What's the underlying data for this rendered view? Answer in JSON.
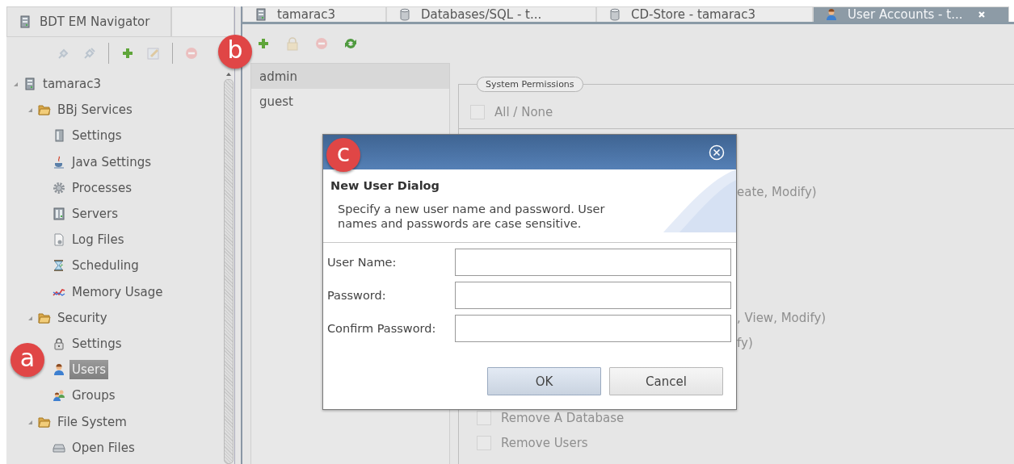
{
  "navigator": {
    "tab": {
      "label": "BDT EM Navigator",
      "selected": true
    },
    "tree": [
      {
        "label": "tamarac3",
        "kind": "server",
        "expanded": true,
        "selected": false,
        "children": [
          {
            "label": "BBj Services",
            "kind": "folder",
            "expanded": true,
            "selected": false,
            "children": [
              {
                "label": "Settings",
                "kind": "settings",
                "selected": false
              },
              {
                "label": "Java Settings",
                "kind": "java",
                "selected": false
              },
              {
                "label": "Processes",
                "kind": "gear",
                "selected": false
              },
              {
                "label": "Servers",
                "kind": "servers",
                "selected": false
              },
              {
                "label": "Log Files",
                "kind": "log",
                "selected": false
              },
              {
                "label": "Scheduling",
                "kind": "schedule",
                "selected": false
              },
              {
                "label": "Memory Usage",
                "kind": "chart",
                "selected": false
              }
            ]
          },
          {
            "label": "Security",
            "kind": "folder",
            "expanded": true,
            "selected": false,
            "children": [
              {
                "label": "Settings",
                "kind": "lock",
                "selected": false
              },
              {
                "label": "Users",
                "kind": "user",
                "selected": true
              },
              {
                "label": "Groups",
                "kind": "group",
                "selected": false
              }
            ]
          },
          {
            "label": "File System",
            "kind": "folder",
            "expanded": true,
            "selected": false,
            "children": [
              {
                "label": "Open Files",
                "kind": "drive",
                "selected": false
              }
            ]
          }
        ]
      }
    ]
  },
  "tabs": [
    {
      "label": "tamarac3",
      "kind": "server",
      "selected": false
    },
    {
      "label": "Databases/SQL - t...",
      "kind": "database",
      "selected": false
    },
    {
      "label": "CD-Store - tamarac3",
      "kind": "database",
      "selected": false
    },
    {
      "label": "User Accounts - t...",
      "kind": "user",
      "selected": true
    }
  ],
  "users": [
    {
      "name": "admin",
      "selected": true
    },
    {
      "name": "guest",
      "selected": false
    }
  ],
  "permissions": {
    "legend": "System Permissions",
    "all_none": {
      "label": "All / None",
      "checked": false
    },
    "rows": [
      {
        "label": "eate, Modify)",
        "kind": "fragment"
      },
      {
        "label": ", View, Modify)",
        "kind": "fragment"
      },
      {
        "label": "fy)",
        "kind": "fragment"
      },
      {
        "label": "Remove A Database",
        "kind": "checkbox",
        "checked": false
      },
      {
        "label": "Remove Users",
        "kind": "checkbox",
        "checked": false
      }
    ]
  },
  "dialog": {
    "title": "New User Dialog",
    "description": "Specify a new user name and password.  User names and passwords are case sensitive.",
    "fields": [
      {
        "label": "User Name:"
      },
      {
        "label": "Password:"
      },
      {
        "label": "Confirm Password:"
      }
    ],
    "buttons": [
      {
        "label": "OK",
        "default": true
      },
      {
        "label": "Cancel",
        "default": false
      }
    ]
  },
  "markers": [
    {
      "label": "a"
    },
    {
      "label": "b"
    },
    {
      "label": "c"
    }
  ]
}
